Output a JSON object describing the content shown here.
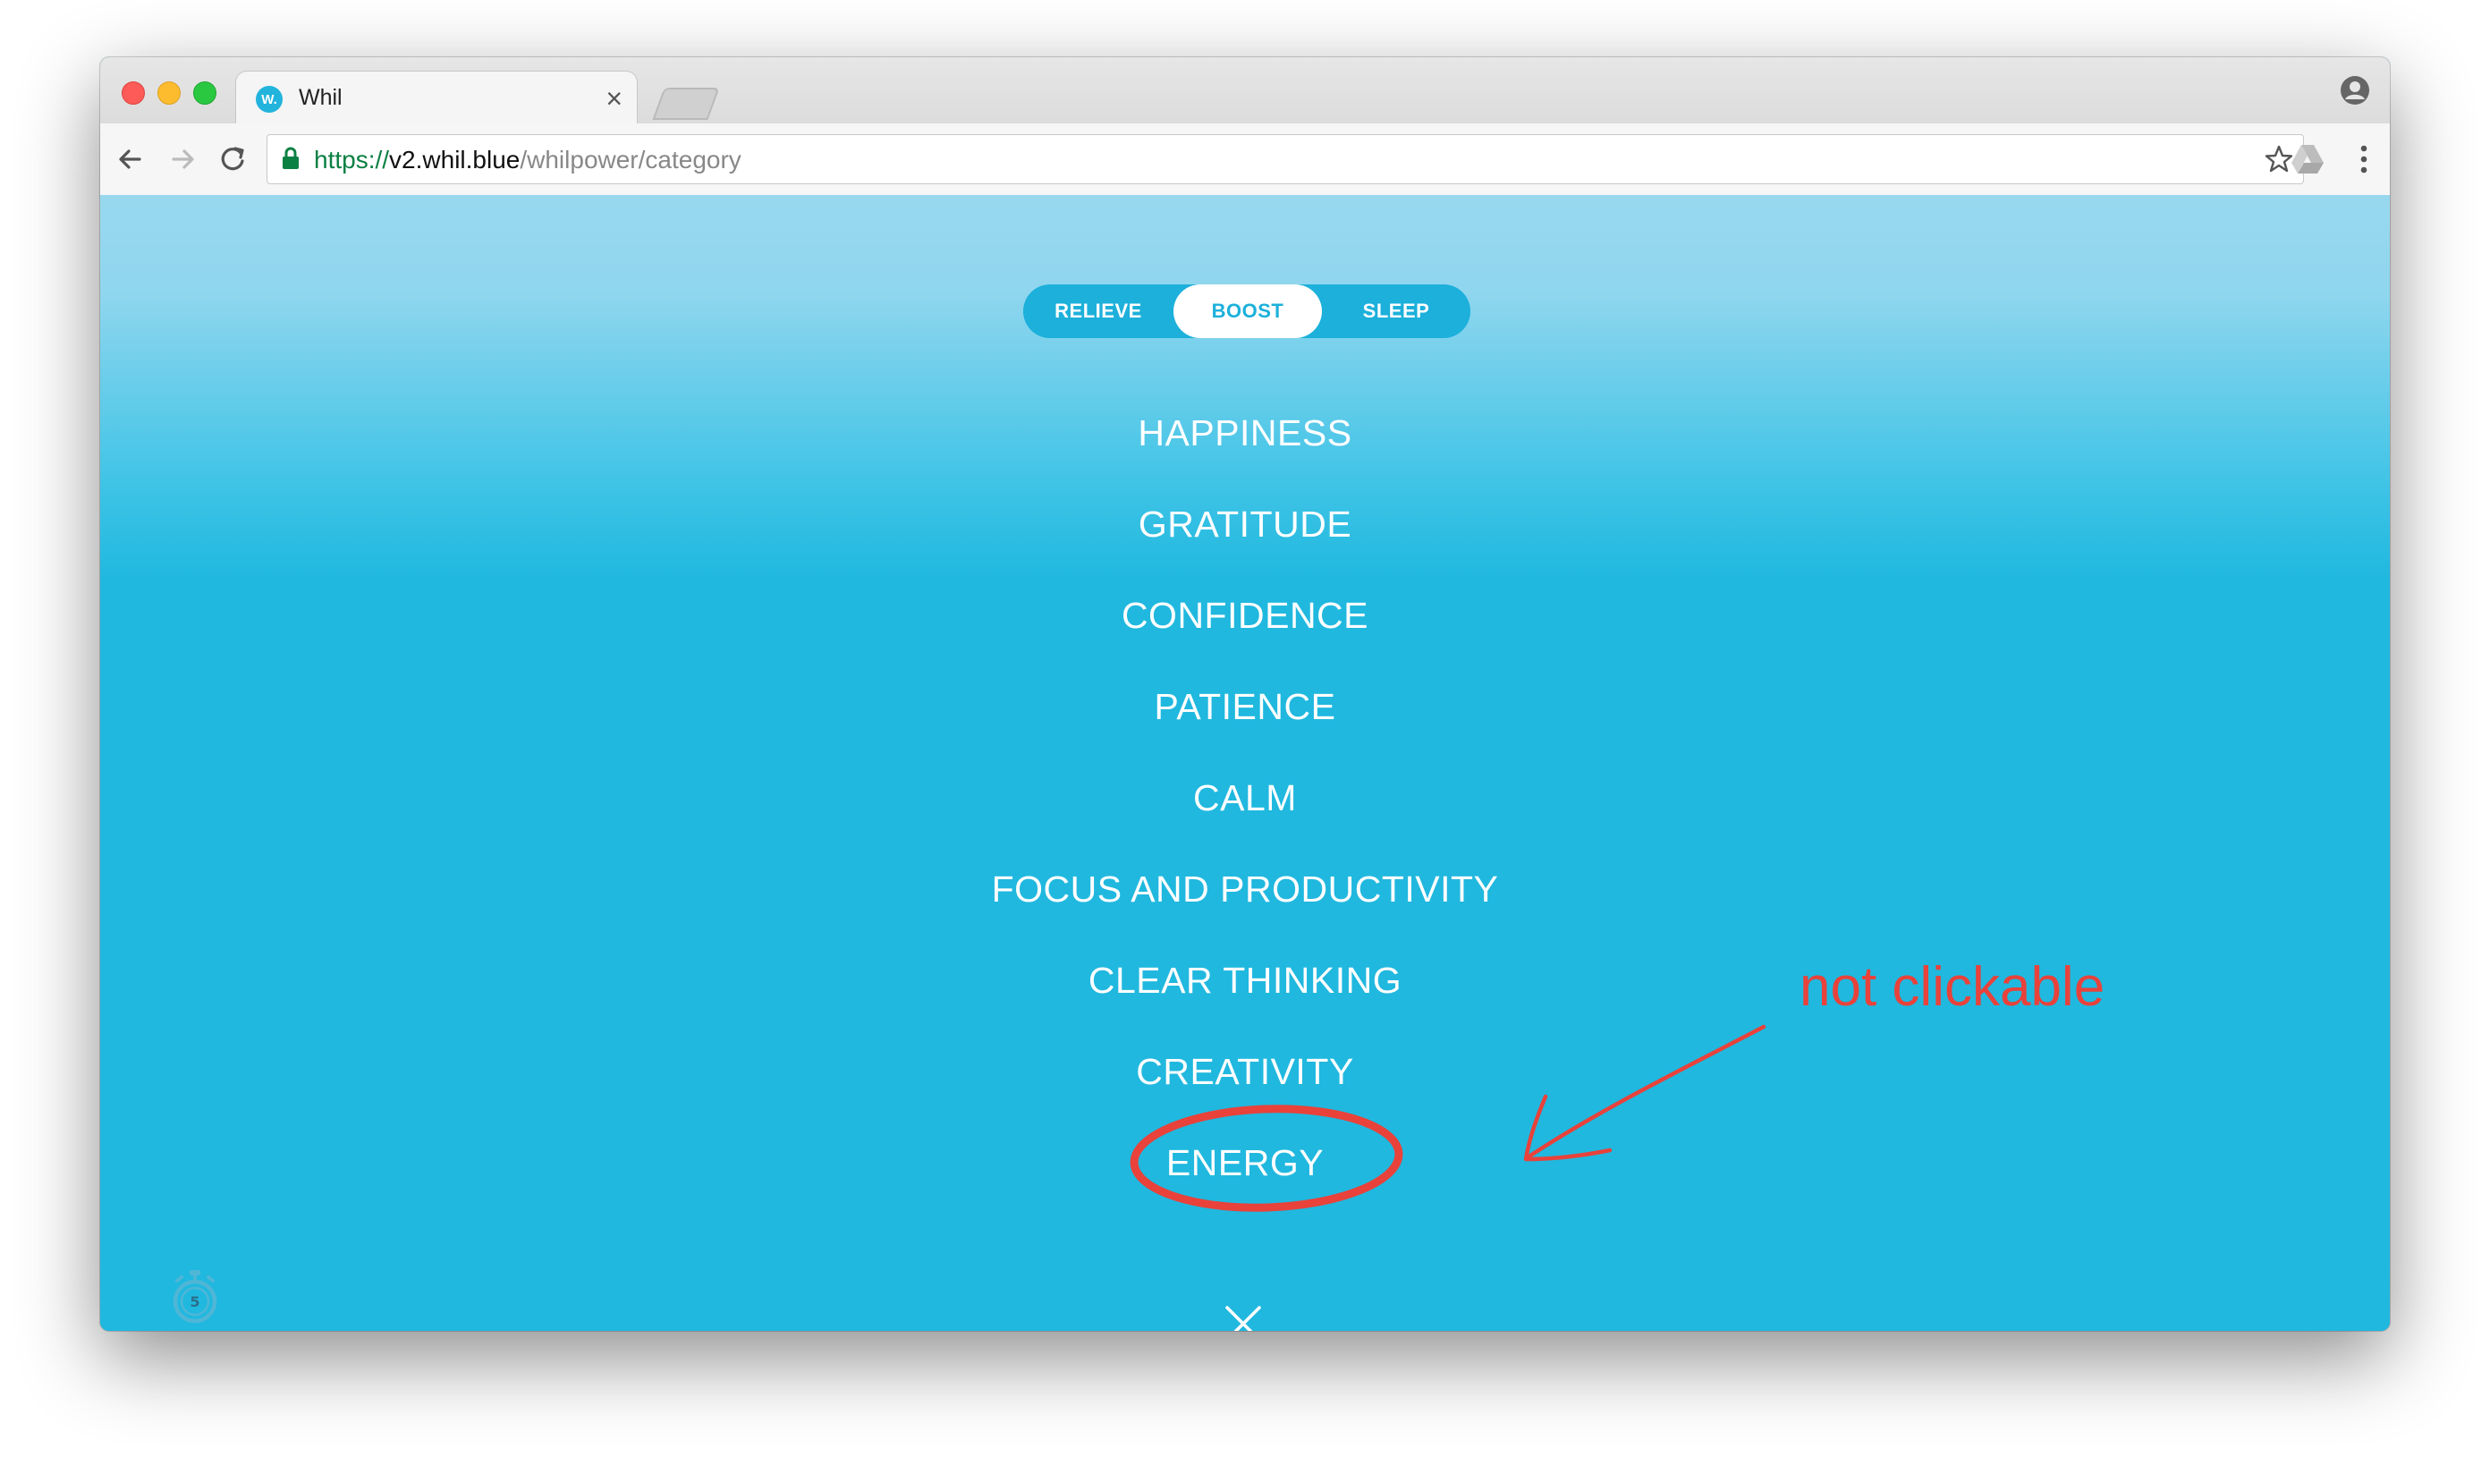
{
  "browser": {
    "tab_title": "Whil",
    "tab_favicon_text": "W.",
    "tab_close": "×",
    "url_scheme": "https://",
    "url_host": "v2.whil.blue",
    "url_path": "/whilpower/category"
  },
  "segments": [
    {
      "label": "RELIEVE",
      "selected": false
    },
    {
      "label": "BOOST",
      "selected": true
    },
    {
      "label": "SLEEP",
      "selected": false
    }
  ],
  "categories": [
    "HAPPINESS",
    "GRATITUDE",
    "CONFIDENCE",
    "PATIENCE",
    "CALM",
    "FOCUS AND PRODUCTIVITY",
    "CLEAR THINKING",
    "CREATIVITY",
    "ENERGY"
  ],
  "timer": {
    "value": "5"
  },
  "annotation": {
    "text": "not clickable",
    "color": "#e8423b"
  },
  "colors": {
    "accent": "#20b8df",
    "selected_bg": "#ffffff"
  }
}
